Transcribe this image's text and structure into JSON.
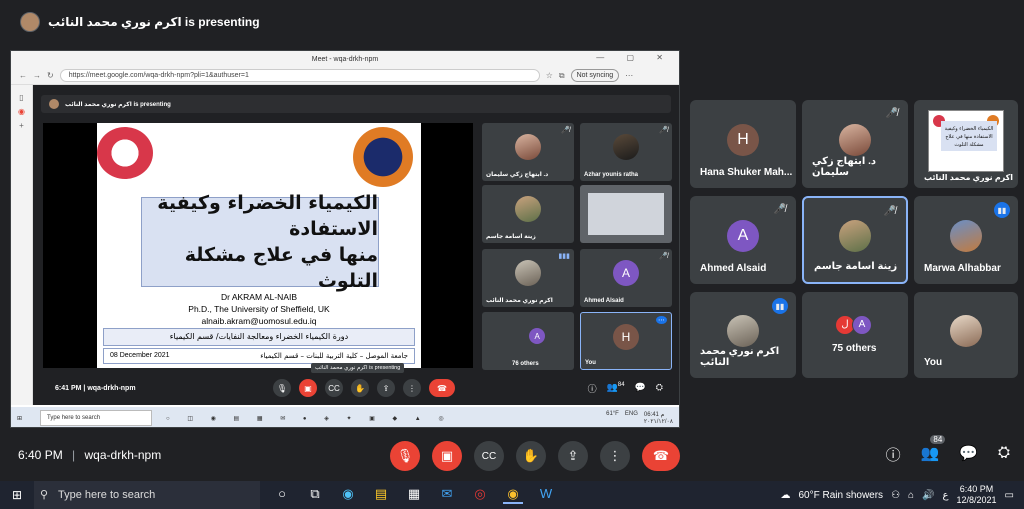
{
  "presenting_banner": "اكرم نوري محمد النائب is presenting",
  "browser": {
    "tab_title": "Meet - wqa-drkh-npm",
    "url": "https://meet.google.com/wqa-drkh-npm?pli=1&authuser=1",
    "sync_label": "Not syncing",
    "inner_banner": "اكرم نوري محمد النائب is presenting",
    "slide": {
      "title_line1": "الكيمياء الخضراء وكيفية الاستفادة",
      "title_line2": "منها في علاج مشكلة التلوث",
      "author": "Dr AKRAM AL-NAIB",
      "affiliation": "Ph.D., The University of Sheffield, UK",
      "email": "alnaib.akram@uomosul.edu.iq",
      "course": "دورة الكيمياء الخضراء ومعالجة النفايات/ قسم الكيمياء",
      "date": "08 December 2021",
      "university": "جامعة الموصل – كلية التربية للبنات – قسم الكيمياء"
    },
    "tiles": [
      {
        "name": "د. ابتهاج زكي سليمان"
      },
      {
        "name": "Azhar younis ratha"
      },
      {
        "name": "زينة اسامة جاسم"
      },
      {
        "name": ""
      },
      {
        "name": "اكرم نوري محمد النائب"
      },
      {
        "name": "Ahmed Alsaid",
        "initial": "A"
      },
      {
        "name": "76 others",
        "initial": "A"
      },
      {
        "name": "You",
        "initial": "H"
      }
    ],
    "time": "6:41 PM",
    "meeting_code": "wqa-drkh-npm",
    "tooltip": "اكرم نوري محمد النائب is presenting",
    "people_count": "84",
    "taskbar_search": "Type here to search",
    "temp": "61°F",
    "lang": "ENG",
    "clock_time": "06:41 م",
    "clock_date": "٢٠٢١/١٢/٠٨"
  },
  "grid": [
    {
      "name": "Hana Shuker Mah...",
      "initial": "H",
      "color": "#795548"
    },
    {
      "name": "د. ابتهاج زكي سليمان"
    },
    {
      "name": "اكرم نوري محمد النائب",
      "thumb_text": "الكيمياء الخضراء وكيفية الاستفادة منها في علاج مشكلة التلوث"
    },
    {
      "name": "Ahmed Alsaid",
      "initial": "A",
      "color": "#7e57c2"
    },
    {
      "name": "زينة اسامة جاسم"
    },
    {
      "name": "Marwa Alhabbar"
    },
    {
      "name": "اكرم نوري محمد النائب"
    },
    {
      "name": "75 others",
      "initial_a": "ل",
      "initial_b": "A"
    },
    {
      "name": "You"
    }
  ],
  "meet_bar": {
    "time": "6:40 PM",
    "separator": "|",
    "meeting_code": "wqa-drkh-npm",
    "people_badge": "84"
  },
  "taskbar": {
    "search_placeholder": "Type here to search",
    "weather": "60°F  Rain showers",
    "lang": "ع",
    "time": "6:40 PM",
    "date": "12/8/2021"
  },
  "colors": {
    "background": "#202124",
    "tile": "#3c4043",
    "end_call": "#ea4335",
    "active_border": "#8ab4f8",
    "speaking": "#1a73e8"
  }
}
